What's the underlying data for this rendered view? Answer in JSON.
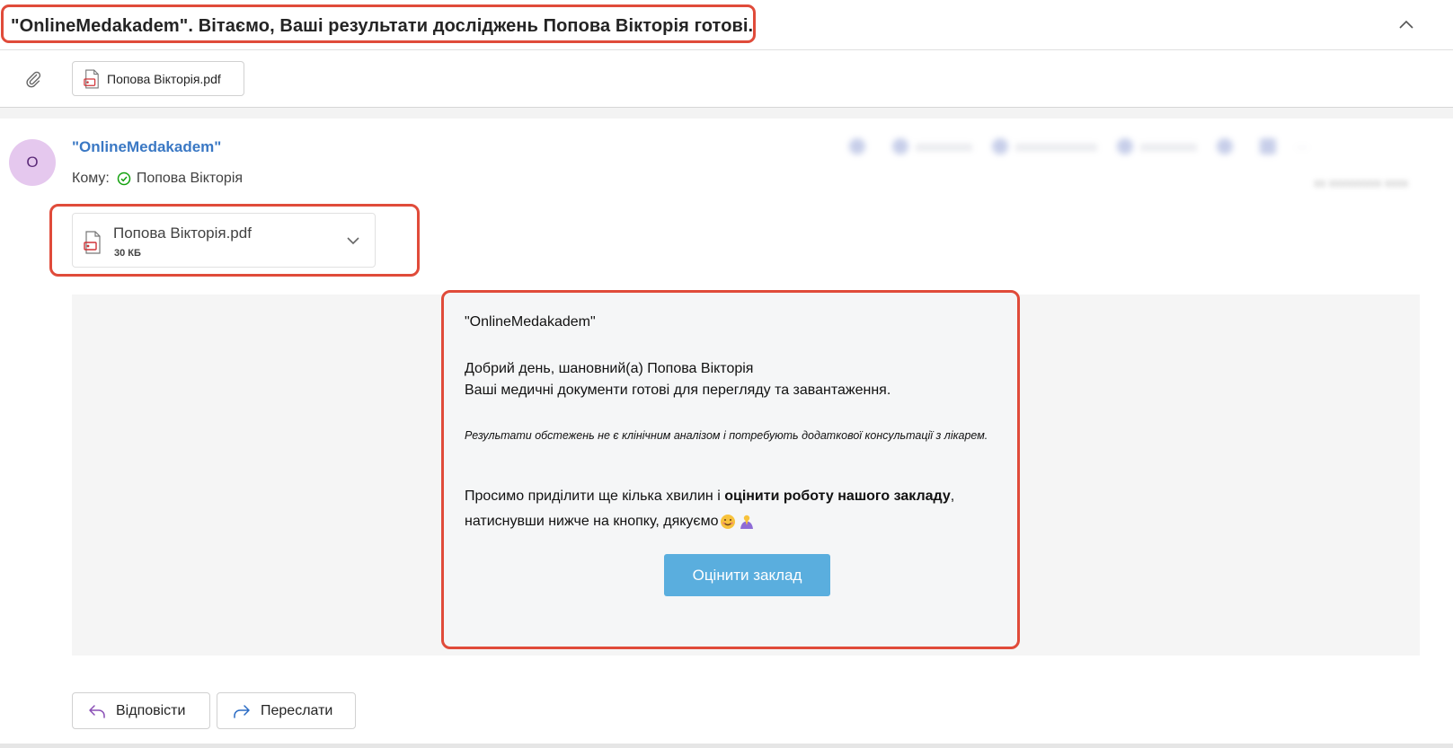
{
  "subject": "\"OnlineMedakadem\". Вітаємо, Ваші результати досліджень Попова Вікторія готові.",
  "attachment_bar": {
    "chip_label": "Попова Вікторія.pdf"
  },
  "message": {
    "avatar_letter": "O",
    "sender": "\"OnlineMedakadem\"",
    "to_label": "Кому:",
    "recipient": "Попова Вікторія"
  },
  "file_card": {
    "name": "Попова Вікторія.pdf",
    "size": "30 КБ"
  },
  "body": {
    "org": "\"OnlineMedakadem\"",
    "greeting": "Добрий день, шановний(а) Попова Вікторія",
    "ready": "Ваші медичні документи готові для перегляду та завантаження.",
    "note": "Результати обстежень не є клінічним аналізом і потребують додаткової консультації з лікарем.",
    "ask_pre": "Просимо приділити ще кілька хвилин і ",
    "ask_bold": "оцінити роботу нашого закладу",
    "ask_post": ", натиснувши нижче на кнопку, дякуємо",
    "rate_button": "Оцінити заклад"
  },
  "footer": {
    "reply_label": "Відповісти",
    "forward_label": "Переслати"
  },
  "colors": {
    "highlight": "#e04b3a",
    "sender_link": "#3a78c4",
    "rate_button": "#5aaede",
    "avatar_bg": "#e5c8ee"
  }
}
